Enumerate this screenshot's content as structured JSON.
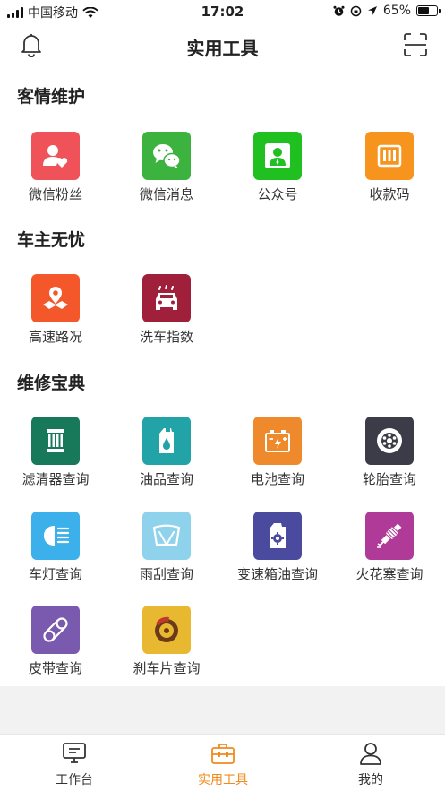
{
  "status_bar": {
    "carrier": "中国移动",
    "time": "17:02",
    "battery": "65%",
    "battery_level": 0.65
  },
  "header": {
    "title": "实用工具",
    "left_icon": "bell-icon",
    "right_icon": "scan-icon"
  },
  "sections": [
    {
      "title": "客情维护",
      "items": [
        {
          "label": "微信粉丝",
          "icon": "fans-icon",
          "color": "#f0525a"
        },
        {
          "label": "微信消息",
          "icon": "wechat-icon",
          "color": "#3bb33e"
        },
        {
          "label": "公众号",
          "icon": "official-account-icon",
          "color": "#20c020"
        },
        {
          "label": "收款码",
          "icon": "payment-code-icon",
          "color": "#f7941d"
        }
      ]
    },
    {
      "title": "车主无忧",
      "items": [
        {
          "label": "高速路况",
          "icon": "map-pin-icon",
          "color": "#f4582a"
        },
        {
          "label": "洗车指数",
          "icon": "car-wash-icon",
          "color": "#a0203c"
        }
      ]
    },
    {
      "title": "维修宝典",
      "items": [
        {
          "label": "滤清器查询",
          "icon": "filter-icon",
          "color": "#17785a"
        },
        {
          "label": "油品查询",
          "icon": "oil-icon",
          "color": "#22a3a8"
        },
        {
          "label": "电池查询",
          "icon": "battery-icon",
          "color": "#ee8a2c"
        },
        {
          "label": "轮胎查询",
          "icon": "tire-icon",
          "color": "#3c3c48"
        },
        {
          "label": "车灯查询",
          "icon": "headlight-icon",
          "color": "#3cb0ea"
        },
        {
          "label": "雨刮查询",
          "icon": "wiper-icon",
          "color": "#8fd2ec"
        },
        {
          "label": "变速箱油查询",
          "icon": "gearbox-oil-icon",
          "color": "#4a4a9e"
        },
        {
          "label": "火花塞查询",
          "icon": "spark-plug-icon",
          "color": "#b03a98"
        },
        {
          "label": "皮带查询",
          "icon": "belt-icon",
          "color": "#7a5aae"
        },
        {
          "label": "刹车片查询",
          "icon": "brake-pad-icon",
          "color": "#e8b830"
        }
      ]
    }
  ],
  "tab_bar": {
    "active_color": "#f08a1d",
    "tabs": [
      {
        "label": "工作台",
        "icon": "workbench-icon"
      },
      {
        "label": "实用工具",
        "icon": "toolbox-icon",
        "active": true
      },
      {
        "label": "我的",
        "icon": "profile-icon"
      }
    ]
  }
}
